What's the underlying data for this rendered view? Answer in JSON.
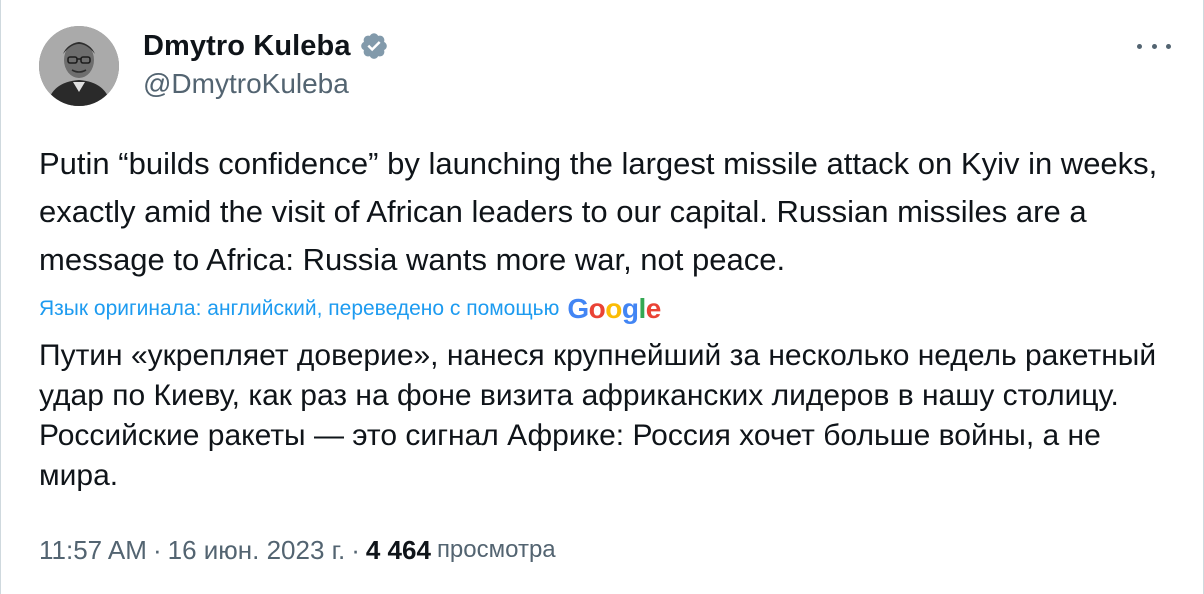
{
  "author": {
    "name": "Dmytro Kuleba",
    "handle": "@DmytroKuleba",
    "verified_icon": "verified-badge-icon",
    "verified_color": "#829aab"
  },
  "menu_icon": "more-horizontal-icon",
  "tweet": {
    "text": "Putin “builds confidence” by launching the largest missile attack on Kyiv in weeks, exactly amid the visit of African leaders to our capital. Russian missiles are a message to Africa: Russia wants more war, not peace."
  },
  "translation": {
    "label": "Язык оригинала: английский, переведено с помощью",
    "provider": "Google",
    "text": "Путин «укрепляет доверие», нанеся крупнейший за несколько недель ракетный удар по Киеву, как раз на фоне визита африканских лидеров в нашу столицу. Российские ракеты — это сигнал Африке: Россия хочет больше войны, а не мира."
  },
  "meta": {
    "time": "11:57 AM",
    "separator": "·",
    "date": "16 июн. 2023 г.",
    "views_count": "4 464",
    "views_label": "просмотра"
  },
  "colors": {
    "link": "#1d9bf0",
    "secondary_text": "#536471",
    "primary_text": "#0f1419"
  }
}
